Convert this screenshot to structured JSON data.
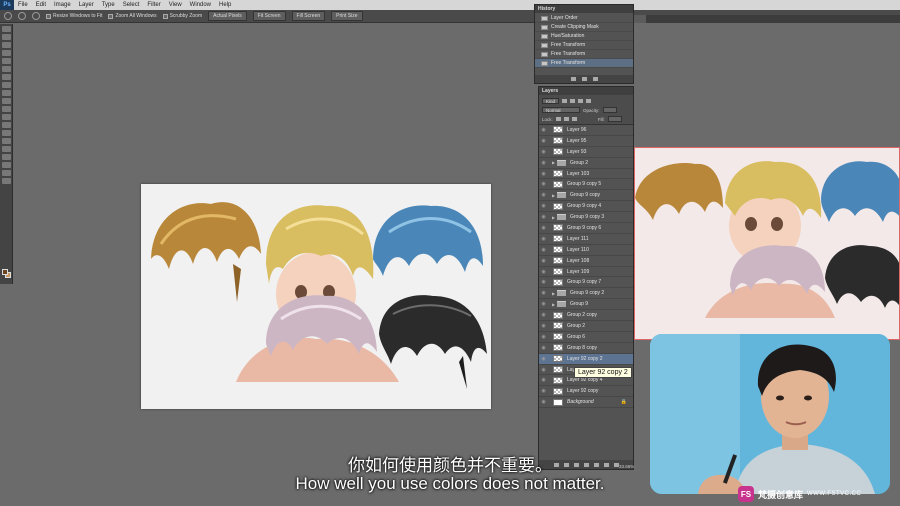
{
  "menu": {
    "app_logo": "Ps",
    "items": [
      "File",
      "Edit",
      "Image",
      "Layer",
      "Type",
      "Select",
      "Filter",
      "View",
      "Window",
      "Help"
    ]
  },
  "options_bar": {
    "resize_windows": "Resize Windows to Fit",
    "zoom_all": "Zoom All Windows",
    "scrubby": "Scrubby Zoom",
    "actual_pixels": "Actual Pixels",
    "fit_screen": "Fit Screen",
    "fill_screen": "Fill Screen",
    "print_size": "Print Size"
  },
  "history": {
    "title": "History",
    "items": [
      "Layer Order",
      "Create Clipping Mask",
      "Hue/Saturation",
      "Free Transform",
      "Free Transform",
      "Free Transform"
    ]
  },
  "layers": {
    "title": "Layers",
    "kind": "Kind",
    "blend": "Normal",
    "opacity_label": "Opacity:",
    "lock_label": "Lock:",
    "fill_label": "Fill:",
    "rows": [
      {
        "name": "Layer 96",
        "type": "layer"
      },
      {
        "name": "Layer 95",
        "type": "layer"
      },
      {
        "name": "Layer 93",
        "type": "layer"
      },
      {
        "name": "Group 2",
        "type": "group"
      },
      {
        "name": "Layer 103",
        "type": "layer"
      },
      {
        "name": "Group 9 copy 5",
        "type": "layer"
      },
      {
        "name": "Group 9 copy",
        "type": "group"
      },
      {
        "name": "Group 9 copy 4",
        "type": "layer"
      },
      {
        "name": "Group 9 copy 3",
        "type": "group"
      },
      {
        "name": "Group 9 copy 6",
        "type": "layer"
      },
      {
        "name": "Layer 111",
        "type": "layer"
      },
      {
        "name": "Layer 110",
        "type": "layer"
      },
      {
        "name": "Layer 108",
        "type": "layer"
      },
      {
        "name": "Layer 109",
        "type": "layer"
      },
      {
        "name": "Group 9 copy 7",
        "type": "layer"
      },
      {
        "name": "Group 9 copy 2",
        "type": "group"
      },
      {
        "name": "Group 9",
        "type": "group"
      },
      {
        "name": "Group 2 copy",
        "type": "layer"
      },
      {
        "name": "Group 2",
        "type": "layer"
      },
      {
        "name": "Group 6",
        "type": "layer"
      },
      {
        "name": "Group 8 copy",
        "type": "layer"
      },
      {
        "name": "Layer 92 copy 2",
        "type": "layer"
      },
      {
        "name": "Layer 92 copy 3",
        "type": "layer"
      },
      {
        "name": "Layer 92 copy 4",
        "type": "layer"
      },
      {
        "name": "Layer 92 copy",
        "type": "layer"
      },
      {
        "name": "Background",
        "type": "background"
      }
    ],
    "tooltip": "Layer 92 copy 2",
    "zoom_readout": "33.66%"
  },
  "subtitles": {
    "chinese": "你如何使用颜色并不重要。",
    "english": "How well you use colors does not matter."
  },
  "watermark": {
    "logo": "FS",
    "brand": "梵摄创意库",
    "url": "WWW.FSTVC.CC"
  },
  "colors": {
    "foreground": "#6b4421",
    "background": "#c89b63",
    "selected_row": "#5d7392"
  }
}
